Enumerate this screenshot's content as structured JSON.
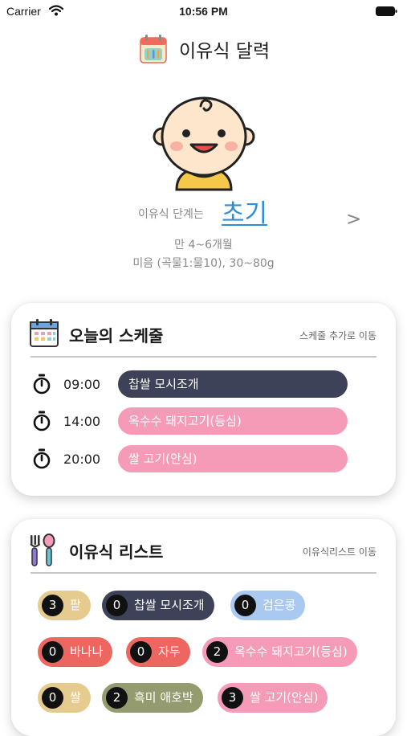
{
  "status_bar": {
    "carrier": "Carrier",
    "time": "10:56 PM"
  },
  "header": {
    "title": "이유식 달력",
    "logo_icon": "calendar-food-icon"
  },
  "stage": {
    "label": "이유식 단계는",
    "value": "초기",
    "next": ">",
    "age": "만 4~6개월",
    "portion": "미음 (곡물1:물10), 30~80g"
  },
  "schedule": {
    "title": "오늘의 스케줄",
    "link": "스케줄 추가로 이동",
    "items": [
      {
        "time": "09:00",
        "food": "찹쌀 모시조개",
        "color": "#3d4258"
      },
      {
        "time": "14:00",
        "food": "옥수수 돼지고기(등심)",
        "color": "#f59bb8"
      },
      {
        "time": "20:00",
        "food": "쌀 고기(안심)",
        "color": "#f59bb8"
      }
    ]
  },
  "food_list": {
    "title": "이유식 리스트",
    "link": "이유식리스트 이동",
    "items": [
      {
        "count": "3",
        "name": "팥",
        "color": "#e5cb8d"
      },
      {
        "count": "0",
        "name": "찹쌀 모시조개",
        "color": "#3d4258"
      },
      {
        "count": "0",
        "name": "검은콩",
        "color": "#a9c9f0"
      },
      {
        "count": "0",
        "name": "바나나",
        "color": "#ee6660"
      },
      {
        "count": "0",
        "name": "자두",
        "color": "#ee6660"
      },
      {
        "count": "2",
        "name": "옥수수 돼지고기(등심)",
        "color": "#f59bb8"
      },
      {
        "count": "0",
        "name": "쌀",
        "color": "#e5cb8d"
      },
      {
        "count": "2",
        "name": "흑미 애호박",
        "color": "#949b6e"
      },
      {
        "count": "3",
        "name": "쌀 고기(안심)",
        "color": "#f59bb8"
      }
    ]
  }
}
